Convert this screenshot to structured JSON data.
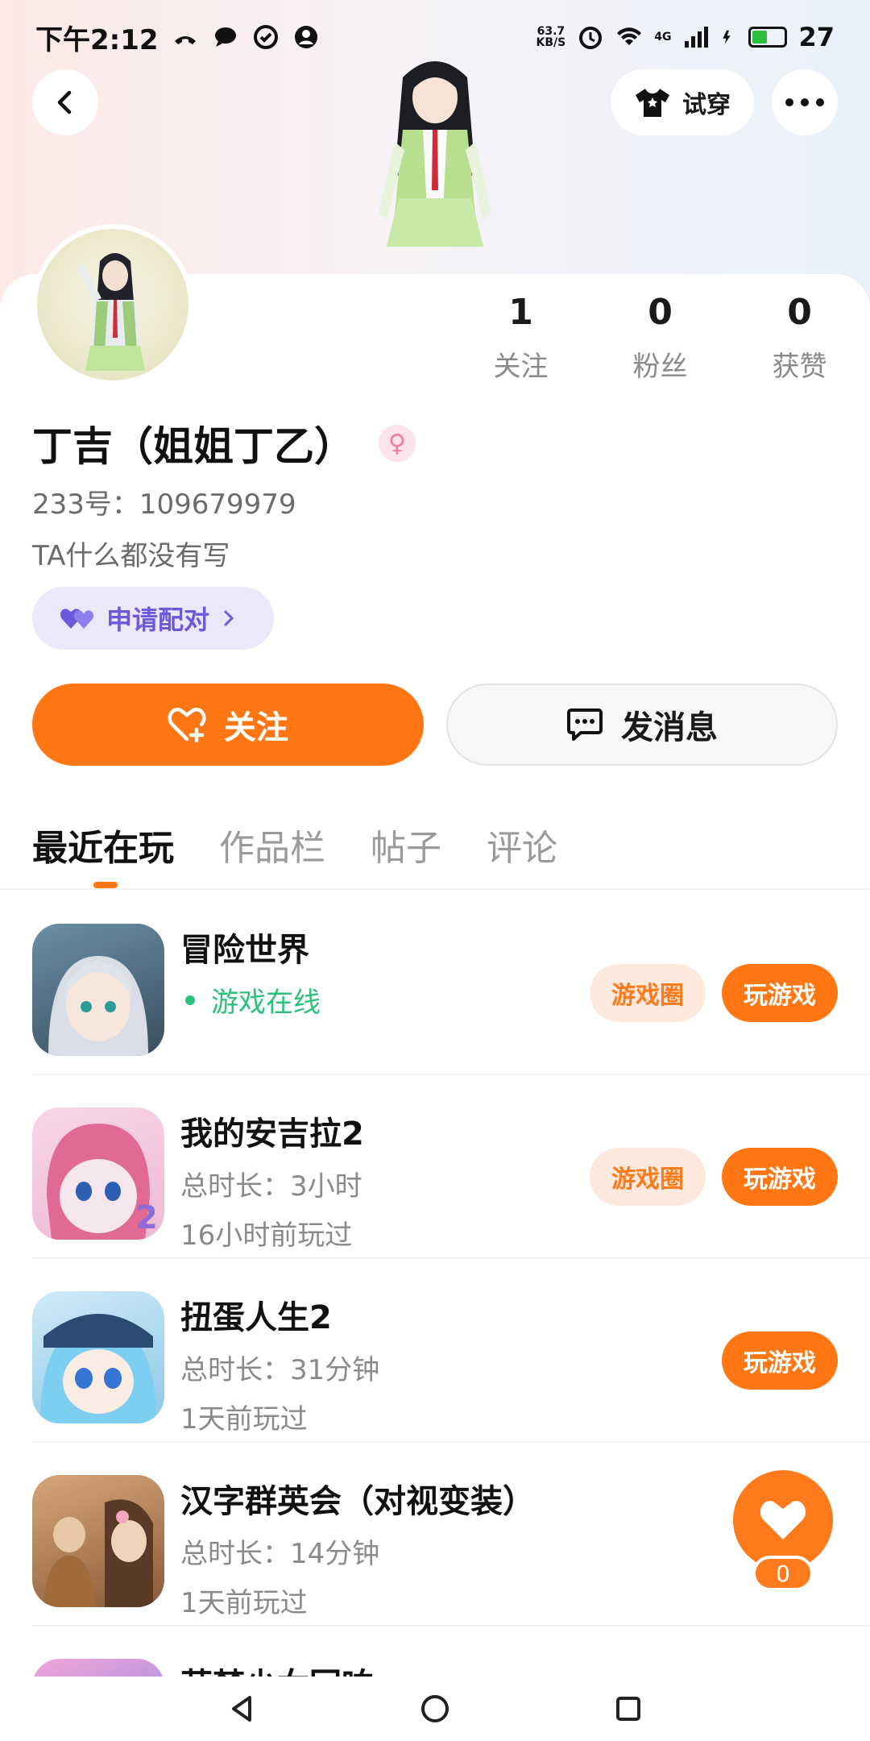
{
  "status_bar": {
    "time": "下午2:12",
    "net_speed_top": "63.7",
    "net_speed_bottom": "KB/S",
    "network_type": "4G",
    "battery": "27"
  },
  "header": {
    "tryon_label": "试穿"
  },
  "profile": {
    "stats": [
      {
        "value": "1",
        "label": "关注"
      },
      {
        "value": "0",
        "label": "粉丝"
      },
      {
        "value": "0",
        "label": "获赞"
      }
    ],
    "name": "丁吉（姐姐丁乙）",
    "uid": "233号：109679979",
    "bio": "TA什么都没有写",
    "pair_label": "申请配对",
    "follow_label": "关注",
    "message_label": "发消息"
  },
  "tabs": [
    "最近在玩",
    "作品栏",
    "帖子",
    "评论"
  ],
  "games": [
    {
      "title": "冒险世界",
      "status": "游戏在线",
      "circle": "游戏圈",
      "play": "玩游戏"
    },
    {
      "title": "我的安吉拉2",
      "duration": "总时长：3小时",
      "last": "16小时前玩过",
      "circle": "游戏圈",
      "play": "玩游戏"
    },
    {
      "title": "扭蛋人生2",
      "duration": "总时长：31分钟",
      "last": "1天前玩过",
      "play": "玩游戏"
    },
    {
      "title": "汉字群英会（对视变装）",
      "duration": "总时长：14分钟",
      "last": "1天前玩过"
    },
    {
      "title": "萌梦少女回响"
    }
  ],
  "like": {
    "count": "0"
  },
  "colors": {
    "accent": "#ff7612",
    "online": "#2bc17a",
    "pair": "#6b5bdc"
  }
}
